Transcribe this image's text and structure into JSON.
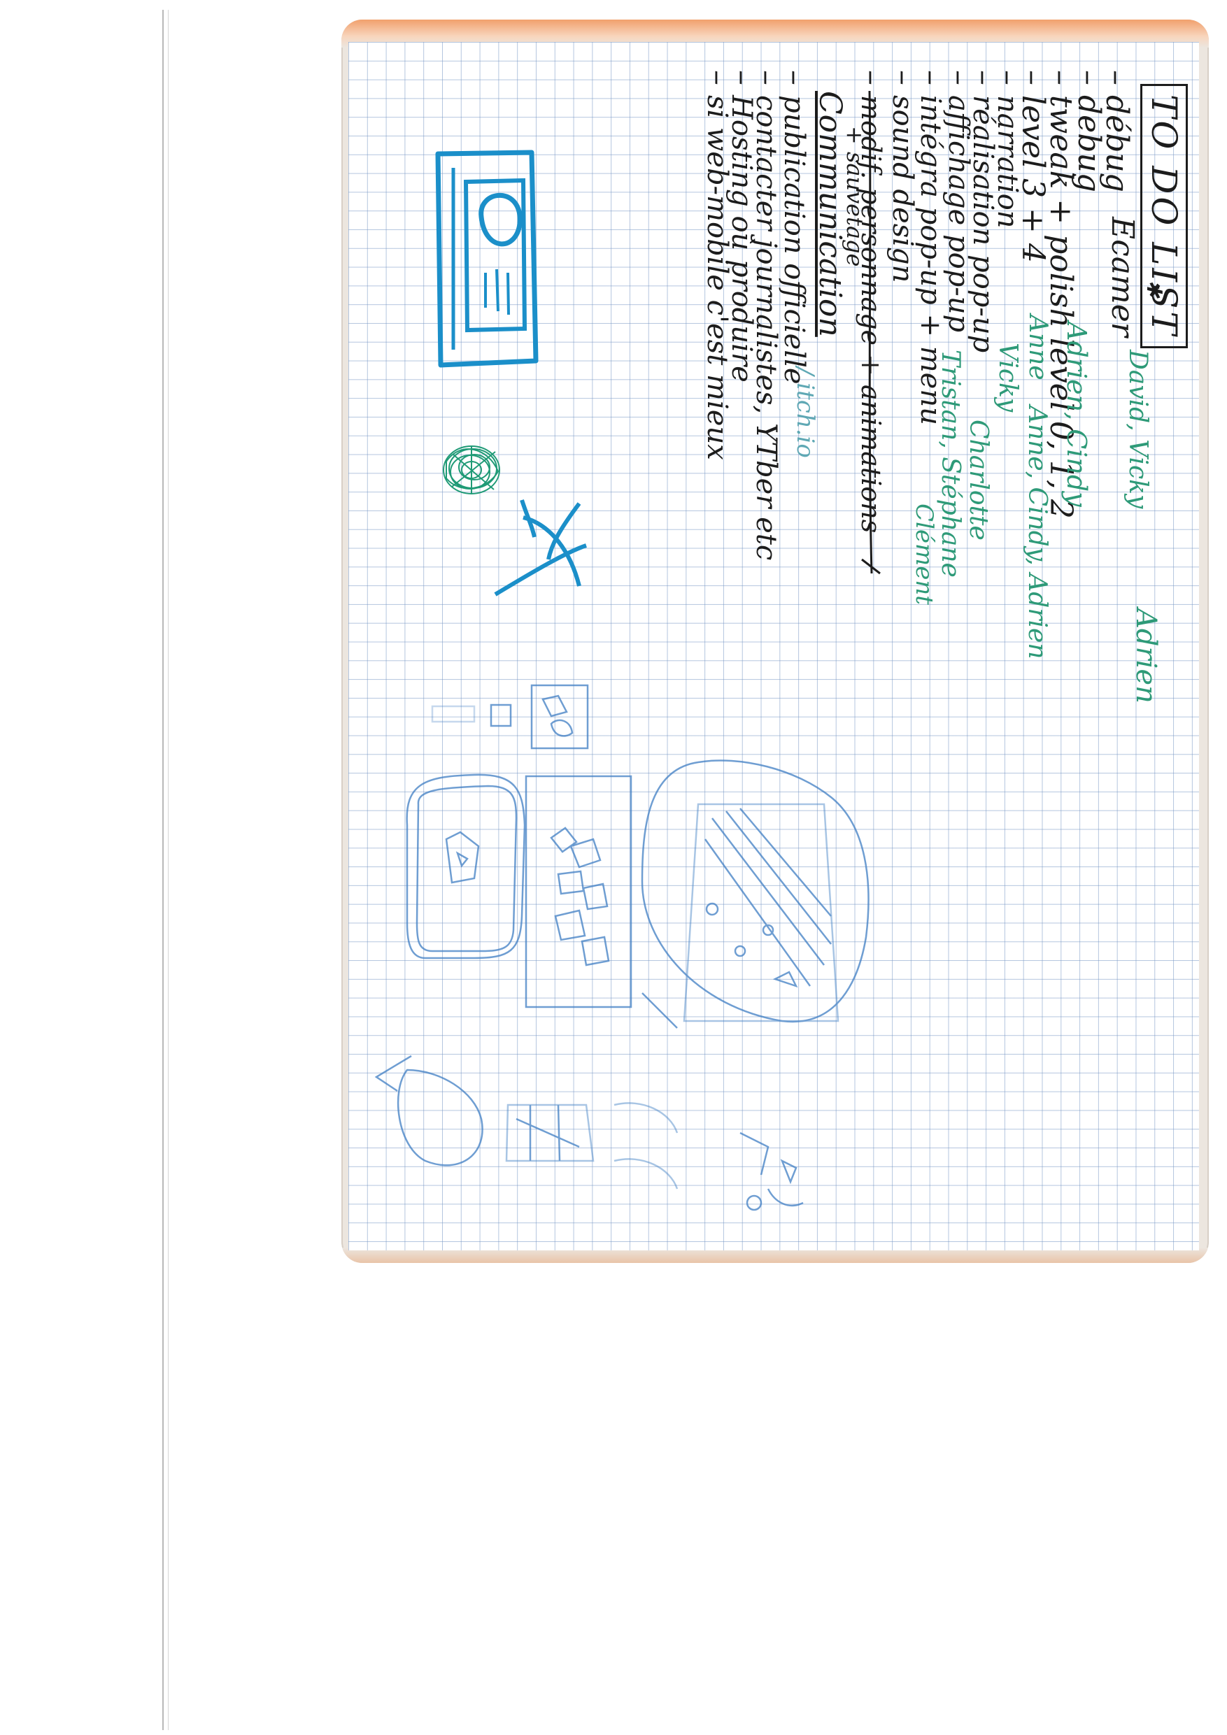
{
  "todo": {
    "title": "TO DO LIST",
    "items": [
      {
        "task": "débug",
        "names": ""
      },
      {
        "task": "debug",
        "names": ""
      },
      {
        "task": "tweak + polish level 0, 1, 2",
        "names": ""
      },
      {
        "task": "level 3 + 4",
        "names": ""
      },
      {
        "task": "narration",
        "names": ""
      },
      {
        "task": "réalisation pop-up",
        "names": ""
      },
      {
        "task": "affichage pop-up",
        "names": ""
      },
      {
        "task": "intégra pop-up + menu",
        "names": ""
      },
      {
        "task": "sound design",
        "names": ""
      },
      {
        "task": "modif. personnage + animations",
        "names": ""
      },
      {
        "task": "+ sauvetage",
        "names": ""
      }
    ],
    "credits": [
      "Ecamer",
      "David, Vicky",
      "Adrien",
      "Adrien, Cindy",
      "Anne",
      "Anne, Cindy, Adrien",
      "Vicky",
      "Charlotte",
      "Tristan, Stéphane",
      "Clément"
    ]
  },
  "communication": {
    "title": "Communication",
    "items": [
      "publication officielle",
      "contacter journalistes, YTber etc",
      "Hosting où produire",
      "si web-mobile c'est mieux"
    ],
    "note": "/ itch.io"
  },
  "colors": {
    "ink": "#1c1c1c",
    "green_ink": "#2e9a78",
    "cyan_marker": "#1b8fc9",
    "pencil_blue": "#3f7ec4",
    "grid": "#7696c4",
    "notebook_edge": "#f1a06c"
  }
}
